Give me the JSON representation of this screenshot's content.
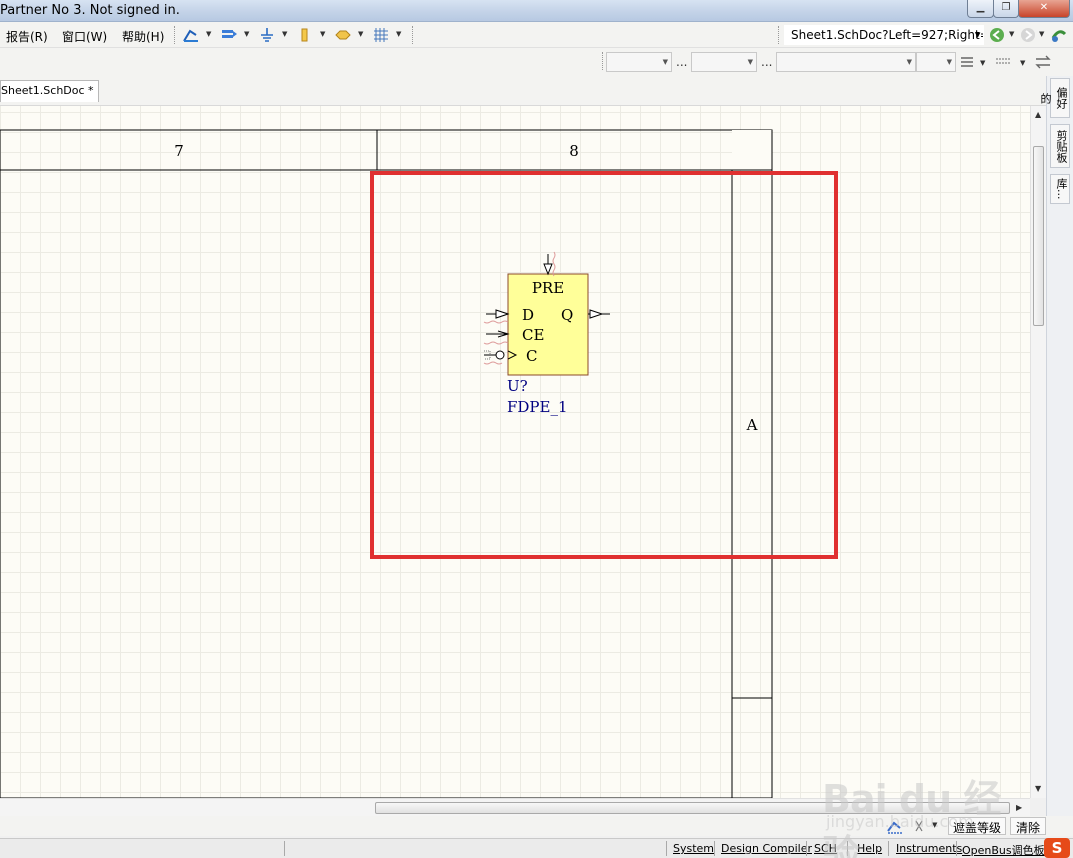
{
  "window": {
    "title": "Partner No 3. Not signed in.",
    "min_glyph": "▁",
    "max_glyph": "❐",
    "close_glyph": "✕"
  },
  "menu": {
    "items": [
      {
        "label": "报告(R)"
      },
      {
        "label": "窗口(W)"
      },
      {
        "label": "帮助(H)"
      }
    ]
  },
  "toolbar": {
    "icons": [
      "wire-tool-icon",
      "bus-tool-icon",
      "ground-icon",
      "part-icon",
      "port-icon",
      "grid-icon"
    ],
    "address": "Sheet1.SchDoc?Left=927;Right=",
    "nav": [
      "back-icon",
      "forward-icon",
      "refresh-icon"
    ]
  },
  "tabs": {
    "active": "Sheet1.SchDoc *"
  },
  "side_panel": {
    "tabs": [
      "偏好的",
      "剪贴板",
      "库..."
    ]
  },
  "sheet": {
    "column_left": "7",
    "column_right": "8",
    "row_label": "A"
  },
  "component": {
    "pins": {
      "pre": "PRE",
      "d": "D",
      "q": "Q",
      "ce": "CE",
      "c": "C"
    },
    "designator": "U?",
    "comment": "FDPE_1",
    "body_color": "#ffff99",
    "designator_color": "#000080"
  },
  "highlight": {
    "color": "#e03030"
  },
  "mask_row": {
    "mask_level": "遮盖等级",
    "clear": "清除"
  },
  "statusbar": {
    "items": [
      "System",
      "Design Compiler",
      "SCH",
      "Help",
      "Instruments",
      "OpenBus调色板"
    ]
  },
  "watermark": {
    "logo": "Bai du 经验",
    "sub": "jingyan.baidu.com"
  }
}
